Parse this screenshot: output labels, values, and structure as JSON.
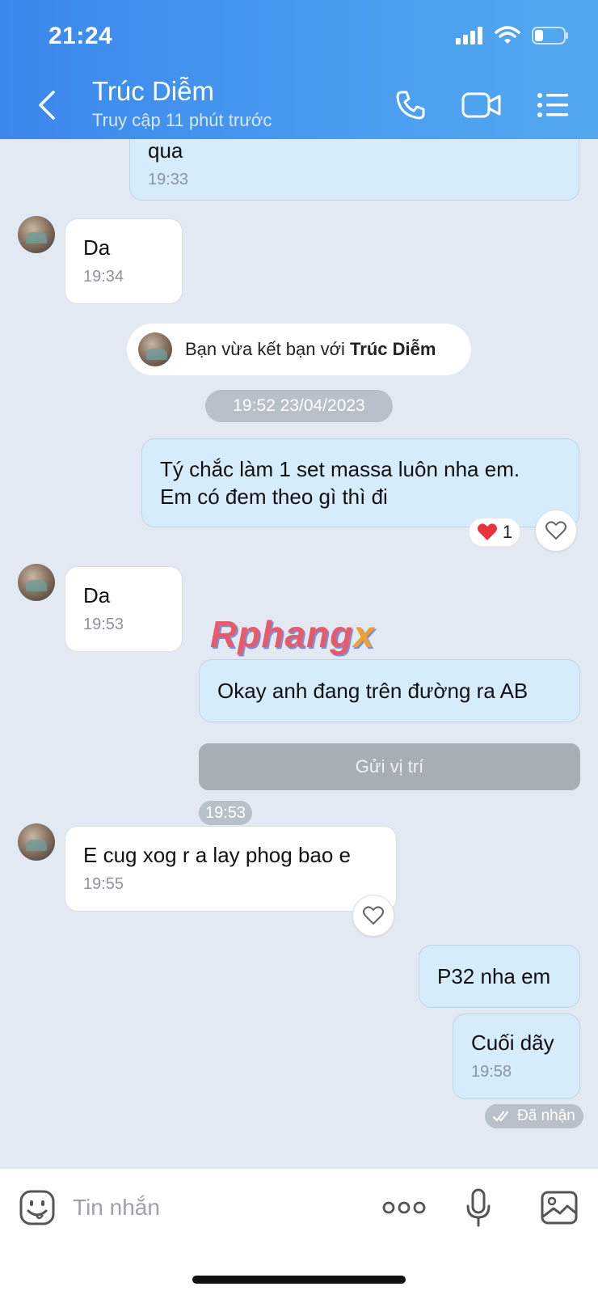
{
  "status_bar": {
    "time": "21:24"
  },
  "header": {
    "title": "Trúc Diễm",
    "subtitle": "Truy cập 11 phút trước"
  },
  "messages": [
    {
      "text": "qua",
      "time": "19:33"
    },
    {
      "text": "Da",
      "time": "19:34"
    },
    {
      "text": "Da",
      "time": "19:53"
    },
    {
      "text": "E cug xog r a lay phog bao e",
      "time": "19:55"
    },
    {
      "text": "Cuối dãy",
      "time": "19:58"
    }
  ],
  "outgoing": {
    "line1": "Tý chắc làm 1 set massa luôn nha em.",
    "line2": "Em có đem theo gì thì đi",
    "okay": "Okay anh đang trên đường ra AB",
    "location_button": "Gửi vị trí",
    "location_time": "19:53",
    "p32": "P32 nha em"
  },
  "system": {
    "friend_prefix": "Bạn vừa kết bạn với ",
    "friend_name": "Trúc Diễm",
    "date_separator": "19:52 23/04/2023"
  },
  "reaction": {
    "count": "1"
  },
  "watermark": {
    "main": "Rphang",
    "x": "x"
  },
  "delivery_status": "Đã nhận",
  "input": {
    "placeholder": "Tin nhắn"
  },
  "colors": {
    "header": "#3b87ec",
    "outgoing_bubble": "#d6ecfb",
    "background": "#e2e9f2"
  },
  "icons": [
    "back-icon",
    "phone-icon",
    "video-icon",
    "list-menu-icon",
    "heart-icon",
    "emoji-icon",
    "more-icon",
    "mic-icon",
    "image-icon",
    "check-icon"
  ]
}
